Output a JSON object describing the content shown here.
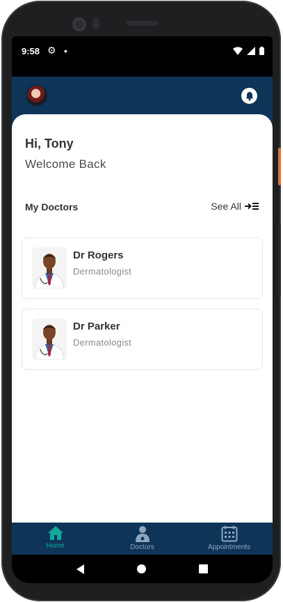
{
  "status_bar": {
    "time": "9:58",
    "icons": [
      "gear-icon",
      "dot-icon",
      "wifi-icon",
      "signal-icon",
      "battery-icon"
    ]
  },
  "header": {
    "avatar_icon": "profile-avatar",
    "bell_icon": "bell-icon"
  },
  "greeting": {
    "title": "Hi, Tony",
    "subtitle": "Welcome Back"
  },
  "my_doctors": {
    "title": "My Doctors",
    "see_all_label": "See All",
    "see_all_icon": "list-arrow-icon",
    "items": [
      {
        "name": "Dr Rogers",
        "specialty": "Dermatologist"
      },
      {
        "name": "Dr Parker",
        "specialty": "Dermatologist"
      }
    ]
  },
  "fab": {
    "label": "+"
  },
  "bottom_nav": {
    "items": [
      {
        "label": "Home",
        "icon": "home-icon",
        "active": true
      },
      {
        "label": "Doctors",
        "icon": "doctor-icon",
        "active": false
      },
      {
        "label": "Appointments",
        "icon": "calendar-icon",
        "active": false
      }
    ]
  },
  "colors": {
    "primary": "#0e3558",
    "accent": "#20d6c3",
    "active_nav": "#11a89a"
  }
}
